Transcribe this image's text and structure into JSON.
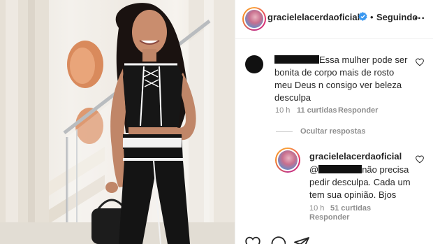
{
  "post_header": {
    "username": "gracielelacerdaoficial",
    "separator": "•",
    "follow_status": "Seguindo",
    "more_label": "..."
  },
  "comment": {
    "author_redacted": true,
    "text_lines": [
      "Essa mulher pode ser",
      "bonita de corpo mais de rosto",
      "meu Deus n consigo ver beleza",
      "desculpa"
    ],
    "time": "10 h",
    "likes": "11 curtidas",
    "reply_label": "Responder"
  },
  "hide_replies_label": "Ocultar respostas",
  "reply": {
    "author": "gracielelacerdaoficial",
    "mention_prefix": "@",
    "text_lines": [
      "não precisa",
      "pedir desculpa. Cada um",
      "tem sua opinião. Bjos"
    ],
    "time": "10 h",
    "likes": "51 curtidas",
    "reply_label": "Responder"
  },
  "colors": {
    "text": "#262626",
    "secondary": "#8e8e8e",
    "verified": "#3897f0",
    "border": "#efefef"
  },
  "icons": [
    "verified-badge-icon",
    "heart-icon",
    "comment-icon",
    "share-icon",
    "more-icon"
  ]
}
